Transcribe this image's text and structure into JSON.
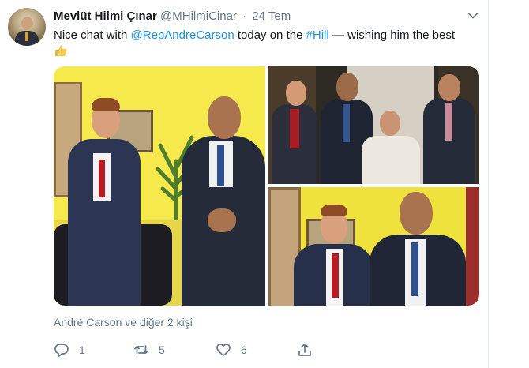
{
  "tweet": {
    "author_name": "Mevlüt Hilmi Çınar",
    "handle": "@MHilmiCinar",
    "separator": "·",
    "date": "24 Tem",
    "text_before": "Nice chat with ",
    "mention": "@RepAndreCarson",
    "text_middle": " today on the ",
    "hashtag": "#Hill",
    "text_after": " — wishing him the best",
    "thumbs_up_emoji": "thumbs-up-icon",
    "tagged_people": "André Carson ve diğer 2 kişi"
  },
  "actions": {
    "reply_count": "1",
    "retweet_count": "5",
    "like_count": "6"
  },
  "icons": [
    "chevron-down-icon",
    "reply-icon",
    "retweet-icon",
    "like-icon",
    "share-icon"
  ],
  "colors": {
    "link": "#1b95e0",
    "secondary_text": "#657786",
    "wall_yellow": "#f5e84a"
  }
}
